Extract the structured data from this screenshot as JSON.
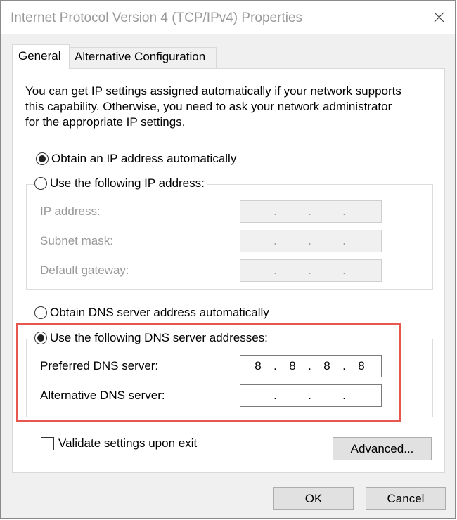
{
  "window": {
    "title": "Internet Protocol Version 4 (TCP/IPv4) Properties"
  },
  "tabs": [
    {
      "label": "General",
      "selected": true
    },
    {
      "label": "Alternative Configuration",
      "selected": false
    }
  ],
  "intro": {
    "line1": "You can get IP settings assigned automatically if your network supports",
    "line2": "this capability. Otherwise, you need to ask your network administrator",
    "line3": "for the appropriate IP settings."
  },
  "ip_mode": {
    "auto_label": "Obtain an IP address automatically",
    "auto_checked": true,
    "manual_label": "Use the following IP address:",
    "manual_checked": false
  },
  "ip_fields": {
    "ip_address_label": "IP address:",
    "subnet_mask_label": "Subnet mask:",
    "default_gateway_label": "Default gateway:",
    "ip_address_value": [
      "",
      "",
      "",
      ""
    ],
    "subnet_mask_value": [
      "",
      "",
      "",
      ""
    ],
    "default_gateway_value": [
      "",
      "",
      "",
      ""
    ]
  },
  "dns_mode": {
    "auto_label": "Obtain DNS server address automatically",
    "auto_checked": false,
    "manual_label": "Use the following DNS server addresses:",
    "manual_checked": true
  },
  "dns_fields": {
    "preferred_label": "Preferred DNS server:",
    "alternative_label": "Alternative DNS server:",
    "preferred_value": [
      "8",
      "8",
      "8",
      "8"
    ],
    "alternative_value": [
      "",
      "",
      "",
      ""
    ]
  },
  "dot": ".",
  "validate": {
    "label": "Validate settings upon exit",
    "checked": false
  },
  "buttons": {
    "advanced": "Advanced...",
    "ok": "OK",
    "cancel": "Cancel"
  },
  "colors": {
    "highlight": "#e8574d",
    "disabled_text": "#9a9a9a"
  },
  "icons": {
    "close": "close-icon"
  }
}
